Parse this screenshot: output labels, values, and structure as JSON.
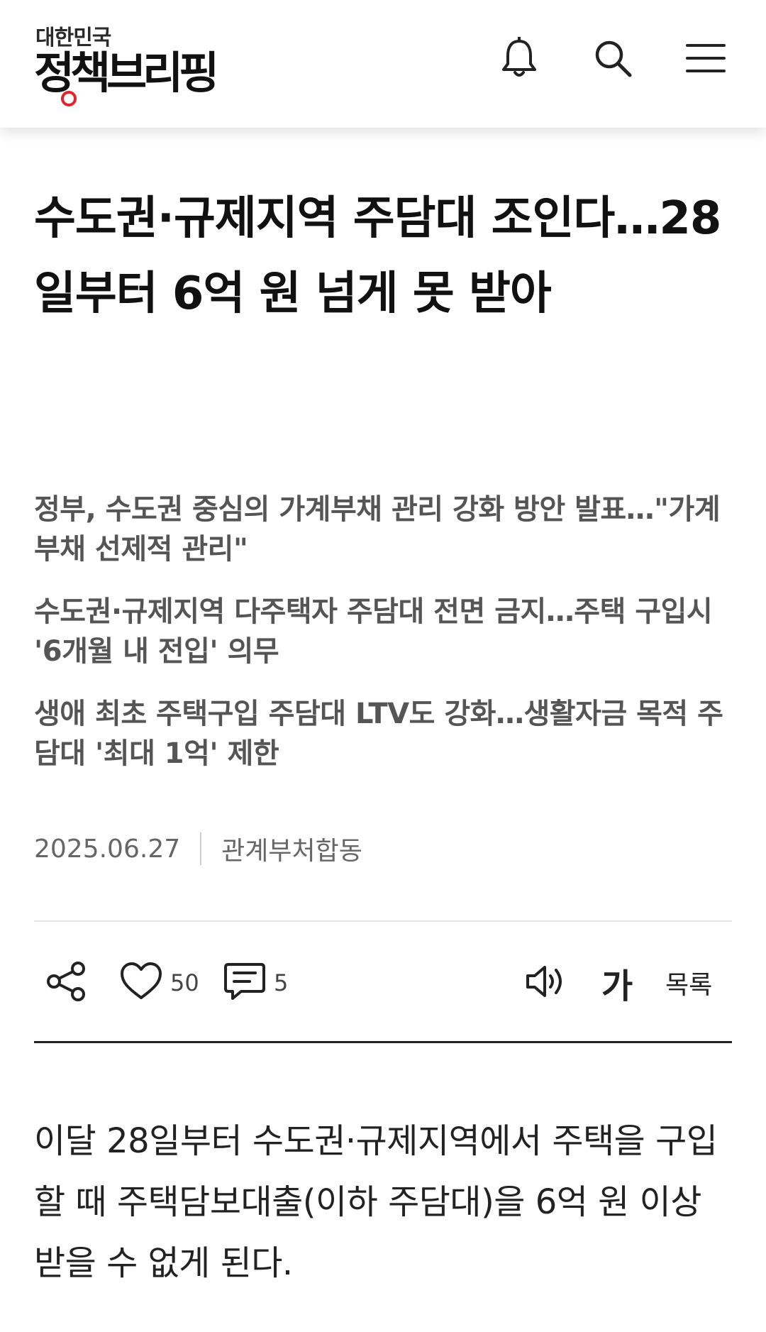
{
  "header": {
    "logo_sub": "대한민국",
    "logo_main": "정책브리핑",
    "icons": [
      "bell-icon",
      "search-icon",
      "menu-icon"
    ]
  },
  "article": {
    "title": "수도권·규제지역 주담대 조인다…28일부터 6억 원 넘게 못 받아",
    "subtitles": [
      "정부, 수도권 중심의 가계부채 관리 강화 방안 발표…\"가계부채 선제적 관리\"",
      "수도권·규제지역 다주택자 주담대 전면 금지…주택 구입시 '6개월 내 전입' 의무",
      "생애 최초 주택구입 주담대 LTV도 강화…생활자금 목적 주담대 '최대 1억' 제한"
    ],
    "date": "2025.06.27",
    "source": "관계부처합동",
    "body": "이달 28일부터 수도권·규제지역에서 주택을 구입할 때 주택담보대출(이하 주담대)을 6억 원 이상 받을 수 없게 된다."
  },
  "toolbar": {
    "like_count": "50",
    "comment_count": "5",
    "font_size_label": "가",
    "list_label": "목록"
  },
  "colors": {
    "brand_red": "#e0242e",
    "text": "#111111",
    "sub_text": "#555555"
  }
}
